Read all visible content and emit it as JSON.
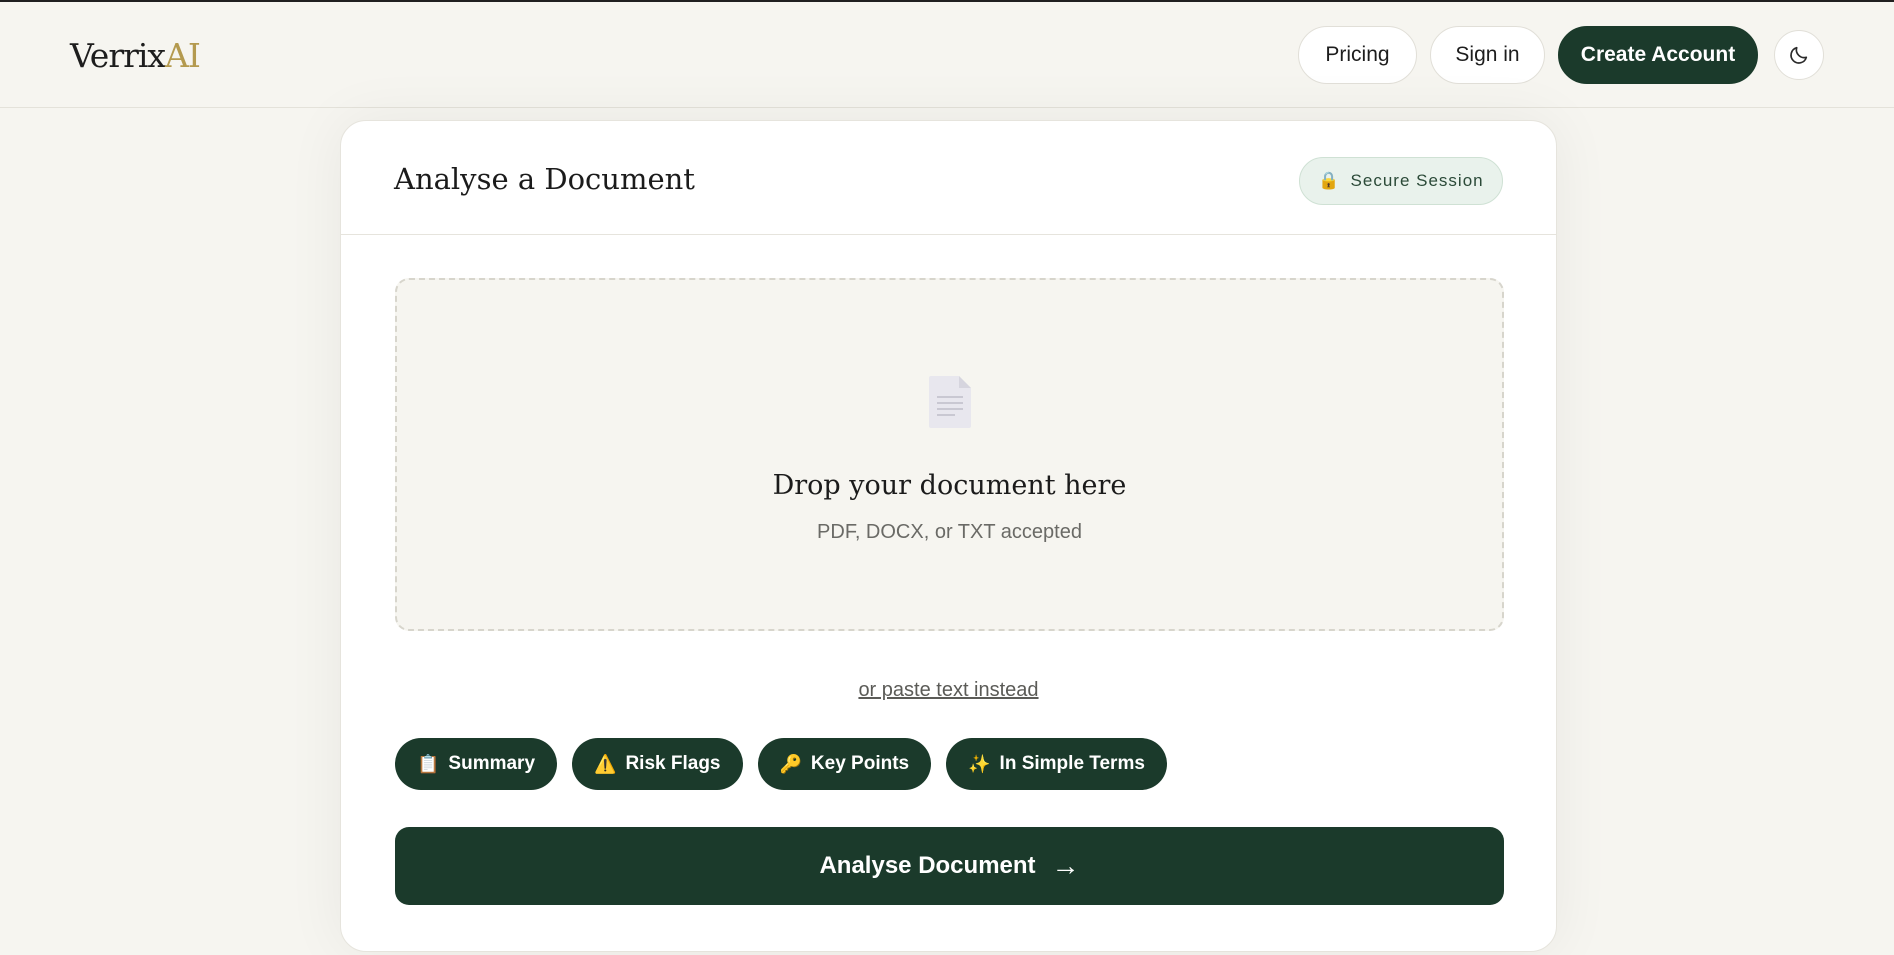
{
  "header": {
    "logo_main": "Verrix",
    "logo_accent": "AI",
    "pricing_label": "Pricing",
    "signin_label": "Sign in",
    "create_account_label": "Create Account",
    "theme_icon": "moon-icon"
  },
  "card": {
    "title": "Analyse a Document",
    "secure_badge": {
      "icon": "🔒",
      "label": "Secure Session"
    },
    "dropzone": {
      "title": "Drop your document here",
      "subtitle": "PDF, DOCX, or TXT accepted"
    },
    "paste_link": "or paste text instead",
    "chips": [
      {
        "icon": "📋",
        "label": "Summary"
      },
      {
        "icon": "⚠️",
        "label": "Risk Flags"
      },
      {
        "icon": "🔑",
        "label": "Key Points"
      },
      {
        "icon": "✨",
        "label": "In Simple Terms"
      }
    ],
    "analyse_button": {
      "label": "Analyse Document",
      "arrow": "→"
    }
  },
  "colors": {
    "background": "#f6f5f0",
    "primary_dark_green": "#1b3a2b",
    "logo_accent_gold": "#b49a4f",
    "secure_badge_bg": "#e9f2ec"
  }
}
